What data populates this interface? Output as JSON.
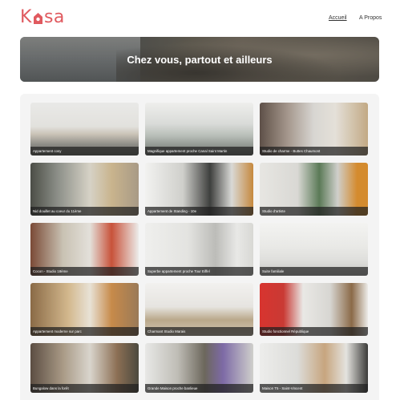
{
  "header": {
    "logo_text": "Kasa",
    "nav": [
      {
        "label": "Accueil",
        "active": true
      },
      {
        "label": "A Propos",
        "active": false
      }
    ]
  },
  "banner": {
    "title": "Chez vous, partout et ailleurs"
  },
  "colors": {
    "brand": "#e05a5f",
    "panel": "#f4f4f4",
    "caption_bg": "#1e1e1e"
  },
  "listings": [
    {
      "title": "Appartement cosy"
    },
    {
      "title": "Magnifique appartement proche Canal Saint Martin"
    },
    {
      "title": "Studio de charme - Buttes Chaumont"
    },
    {
      "title": "Nid douillet au coeur du 11ème"
    },
    {
      "title": "Appartement de Standing - 10e"
    },
    {
      "title": "Studio d'artiste"
    },
    {
      "title": "Cocon - Studio 18ème"
    },
    {
      "title": "Superbe appartement proche Tour Eiffel"
    },
    {
      "title": "Suite familiale"
    },
    {
      "title": "Appartement moderne sur parc"
    },
    {
      "title": "Charmant Studio Marais"
    },
    {
      "title": "Studio fonctionnel République"
    },
    {
      "title": "Bungalow dans la forêt"
    },
    {
      "title": "Grande Maison proche banlieue"
    },
    {
      "title": "Maison T5 - Saint-Vincent"
    }
  ]
}
